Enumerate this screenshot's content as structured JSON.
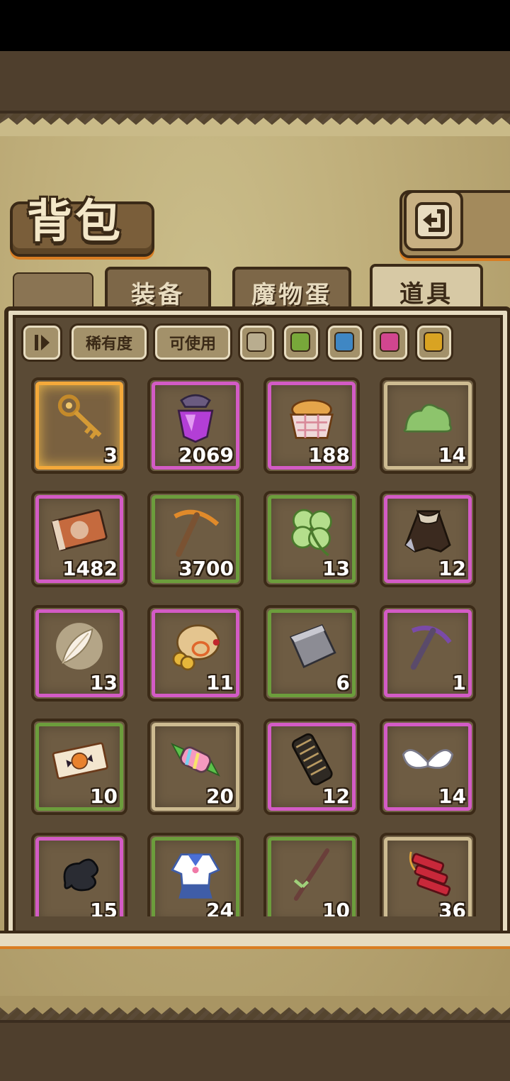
{
  "header": {
    "title": "背包"
  },
  "tabs": [
    {
      "label": "装备",
      "active": false
    },
    {
      "label": "魔物蛋",
      "active": false
    },
    {
      "label": "道具",
      "active": true
    }
  ],
  "filters": {
    "rarity_label": "稀有度",
    "usable_label": "可使用",
    "swatch_colors": [
      "#b9ad8f",
      "#78a83a",
      "#3f87c4",
      "#d1468f",
      "#d9a322"
    ]
  },
  "items": [
    {
      "icon": "golden-key-icon",
      "count": "3",
      "rarity": "gold"
    },
    {
      "icon": "purple-potion-icon",
      "count": "2069",
      "rarity": "pink"
    },
    {
      "icon": "bread-basket-icon",
      "count": "188",
      "rarity": "pink"
    },
    {
      "icon": "green-slime-icon",
      "count": "14",
      "rarity": "tan"
    },
    {
      "icon": "ticket-card-icon",
      "count": "1482",
      "rarity": "pink"
    },
    {
      "icon": "pickaxe-icon",
      "count": "3700",
      "rarity": "green"
    },
    {
      "icon": "four-leaf-clover-icon",
      "count": "13",
      "rarity": "green"
    },
    {
      "icon": "dark-cloak-icon",
      "count": "12",
      "rarity": "pink"
    },
    {
      "icon": "white-feather-icon",
      "count": "13",
      "rarity": "pink"
    },
    {
      "icon": "gold-coin-sack-icon",
      "count": "11",
      "rarity": "pink"
    },
    {
      "icon": "metal-ingot-icon",
      "count": "6",
      "rarity": "green"
    },
    {
      "icon": "purple-pickaxe-icon",
      "count": "1",
      "rarity": "pink"
    },
    {
      "icon": "pumpkin-ticket-icon",
      "count": "10",
      "rarity": "green"
    },
    {
      "icon": "candy-icon",
      "count": "20",
      "rarity": "tan"
    },
    {
      "icon": "dark-scroll-icon",
      "count": "12",
      "rarity": "pink"
    },
    {
      "icon": "angel-wings-icon",
      "count": "14",
      "rarity": "pink"
    },
    {
      "icon": "black-dragon-icon",
      "count": "15",
      "rarity": "pink"
    },
    {
      "icon": "sailor-uniform-icon",
      "count": "24",
      "rarity": "green"
    },
    {
      "icon": "wooden-wand-icon",
      "count": "10",
      "rarity": "green"
    },
    {
      "icon": "firecracker-icon",
      "count": "36",
      "rarity": "tan"
    }
  ]
}
